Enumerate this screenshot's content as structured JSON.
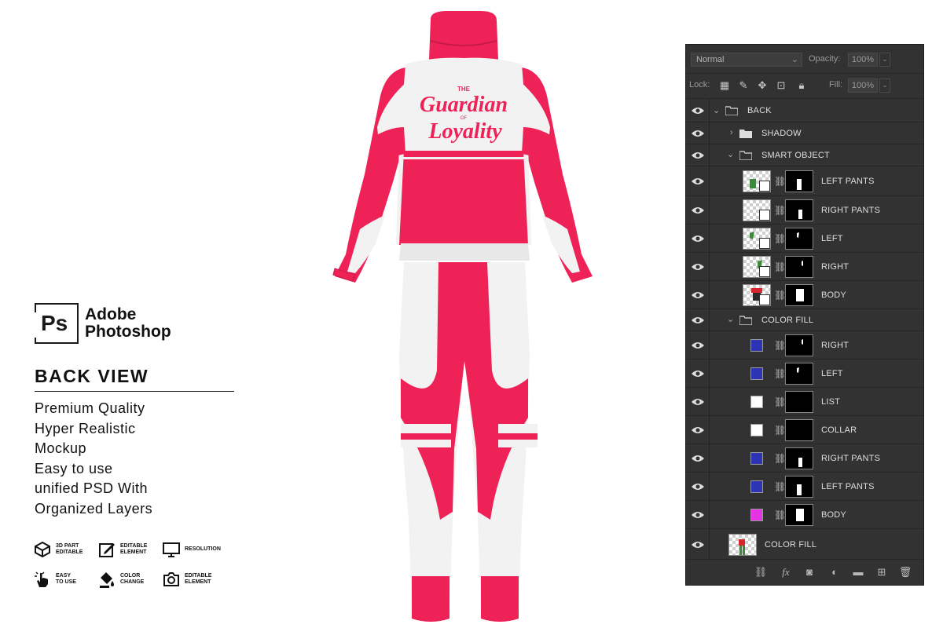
{
  "branding": {
    "logo_text": "Ps",
    "name_line1": "Adobe",
    "name_line2": "Photoshop"
  },
  "view_title": "BACK VIEW",
  "features": [
    "Premium Quality",
    "Hyper Realistic",
    "Mockup",
    "Easy to use",
    "unified PSD With",
    "Organized Layers"
  ],
  "badges": [
    {
      "icon": "3d-cube-icon",
      "line1": "3D PART",
      "line2": "EDITABLE"
    },
    {
      "icon": "edit-pencil-icon",
      "line1": "EDITABLE",
      "line2": "ELEMENT"
    },
    {
      "icon": "monitor-icon",
      "line1": "RESOLUTION",
      "line2": ""
    },
    {
      "icon": "hand-click-icon",
      "line1": "EASY",
      "line2": "TO USE"
    },
    {
      "icon": "paint-bucket-icon",
      "line1": "COLOR",
      "line2": "CHANGE"
    },
    {
      "icon": "camera-icon",
      "line1": "EDITABLE",
      "line2": "ELEMENT"
    }
  ],
  "artwork": {
    "print_small": "THE",
    "print_line1": "Guardian",
    "print_of": "OF",
    "print_line2": "Loyality",
    "colors": {
      "primary": "#ee2257",
      "secondary": "#f2f2f2"
    }
  },
  "layers_panel": {
    "blend_mode": "Normal",
    "opacity_label": "Opacity:",
    "opacity_value": "100%",
    "lock_label": "Lock:",
    "fill_label": "Fill:",
    "fill_value": "100%",
    "layers": [
      {
        "name": "BACK",
        "type": "group",
        "expanded": true
      },
      {
        "name": "SHADOW",
        "type": "group",
        "expanded": false
      },
      {
        "name": "SMART OBJECT",
        "type": "group",
        "expanded": true
      },
      {
        "name": "LEFT PANTS",
        "type": "smart"
      },
      {
        "name": "RIGHT PANTS",
        "type": "smart"
      },
      {
        "name": "LEFT",
        "type": "smart"
      },
      {
        "name": "RIGHT",
        "type": "smart"
      },
      {
        "name": "BODY",
        "type": "smart"
      },
      {
        "name": "COLOR FILL",
        "type": "group",
        "expanded": true
      },
      {
        "name": "RIGHT",
        "type": "fill",
        "color": "#2b35b5"
      },
      {
        "name": "LEFT",
        "type": "fill",
        "color": "#2b35b5"
      },
      {
        "name": "LIST",
        "type": "fill",
        "color": "#ffffff"
      },
      {
        "name": "COLLAR",
        "type": "fill",
        "color": "#ffffff"
      },
      {
        "name": "RIGHT PANTS",
        "type": "fill",
        "color": "#2b35b5"
      },
      {
        "name": "LEFT PANTS",
        "type": "fill",
        "color": "#2b35b5"
      },
      {
        "name": "BODY",
        "type": "fill",
        "color": "#e534e5"
      },
      {
        "name": "COLOR FILL",
        "type": "layer"
      }
    ],
    "bottom_icons": [
      "link-icon",
      "fx-icon",
      "mask-icon",
      "adjustment-icon",
      "folder-icon",
      "new-layer-icon",
      "trash-icon"
    ]
  }
}
